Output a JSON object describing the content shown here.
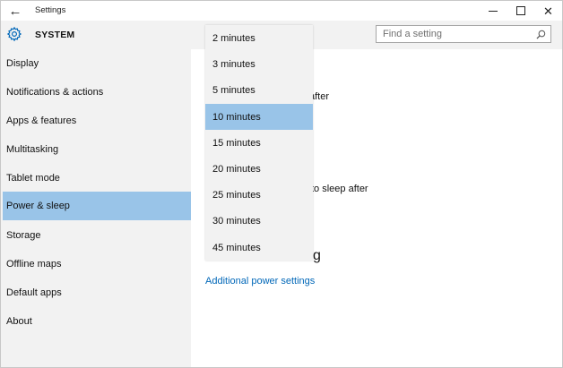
{
  "window": {
    "title": "Settings",
    "controls": {
      "minimize_icon": "minimize-icon",
      "maximize_icon": "maximize-icon",
      "close_icon": "close-icon"
    }
  },
  "header": {
    "section": "SYSTEM",
    "icon": "gear-icon",
    "search": {
      "placeholder": "Find a setting",
      "icon": "search-icon"
    }
  },
  "sidebar": {
    "items": [
      {
        "label": "Display",
        "selected": false
      },
      {
        "label": "Notifications & actions",
        "selected": false
      },
      {
        "label": "Apps & features",
        "selected": false
      },
      {
        "label": "Multitasking",
        "selected": false
      },
      {
        "label": "Tablet mode",
        "selected": false
      },
      {
        "label": "Power & sleep",
        "selected": true
      },
      {
        "label": "Storage",
        "selected": false
      },
      {
        "label": "Offline maps",
        "selected": false
      },
      {
        "label": "Default apps",
        "selected": false
      },
      {
        "label": "About",
        "selected": false
      }
    ]
  },
  "main": {
    "partial_text_1": "after",
    "partial_text_2": "to sleep after",
    "partial_text_3": "g",
    "link": "Additional power settings"
  },
  "dropdown": {
    "options": [
      "2 minutes",
      "3 minutes",
      "5 minutes",
      "10 minutes",
      "15 minutes",
      "20 minutes",
      "25 minutes",
      "30 minutes",
      "45 minutes"
    ],
    "selected": "10 minutes"
  },
  "colors": {
    "selection": "#99c4e8",
    "panel_gray": "#f2f2f2",
    "link": "#0067b8",
    "accent_icon": "#0067b8"
  }
}
